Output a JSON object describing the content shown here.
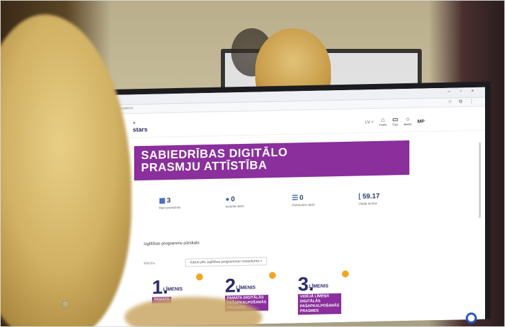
{
  "browser": {
    "url": "sabiedribas.stars.lv",
    "window_controls": "– ▫ ×",
    "toolbar_icons": "☆ ⧉ ⋮"
  },
  "app": {
    "logo_text": "stars",
    "logo_mark": "♣",
    "language": "LV ˅",
    "header_icons": [
      {
        "icon": "profile-icon",
        "label": "Profils"
      },
      {
        "icon": "chat-icon",
        "label": "Čats"
      },
      {
        "icon": "search-icon",
        "label": "Meklēt"
      }
    ],
    "user_initials": "MP"
  },
  "banner": {
    "line1": "SABIEDRĪBAS DIGITĀLO",
    "line2": "PRASMJU ATTĪSTĪBA"
  },
  "stats": [
    {
      "icon": "grid-icon",
      "value": "3",
      "label": "Mani priekšmeti"
    },
    {
      "icon": "users-icon",
      "value": "0",
      "label": "Iesūtītie darbi"
    },
    {
      "icon": "list-icon",
      "value": "0",
      "label": "Pārbaudes darbi"
    },
    {
      "icon": "chart-icon",
      "value": "59.17",
      "label": "Vidējā atzīme"
    }
  ],
  "section_title": "Izglītības programmu pārskats",
  "filter": {
    "label": "Mācību",
    "select_value": "Kārtot pēc izglītības programmas nosaukuma ˅"
  },
  "cards": [
    {
      "num": "1.",
      "level": "LĪMENIS",
      "tag_lines": [
        "PAMATA"
      ]
    },
    {
      "num": "2.",
      "level": "LĪMENIS",
      "tag_lines": [
        "PAMATA DIGITĀLĀS",
        "PAŠAPKALPOŠANĀS",
        "PRASMES"
      ]
    },
    {
      "num": "3.",
      "level": "LĪMENIS",
      "tag_lines": [
        "VIDĒJĀ LĪMEŅA",
        "DIGITĀLĀS",
        "PAŠAPKALPOŠANĀS",
        "PRASMES"
      ]
    }
  ],
  "colors": {
    "brand_purple": "#8a2f9c",
    "accent_orange": "#f4a622",
    "navy": "#2b2b6a"
  }
}
